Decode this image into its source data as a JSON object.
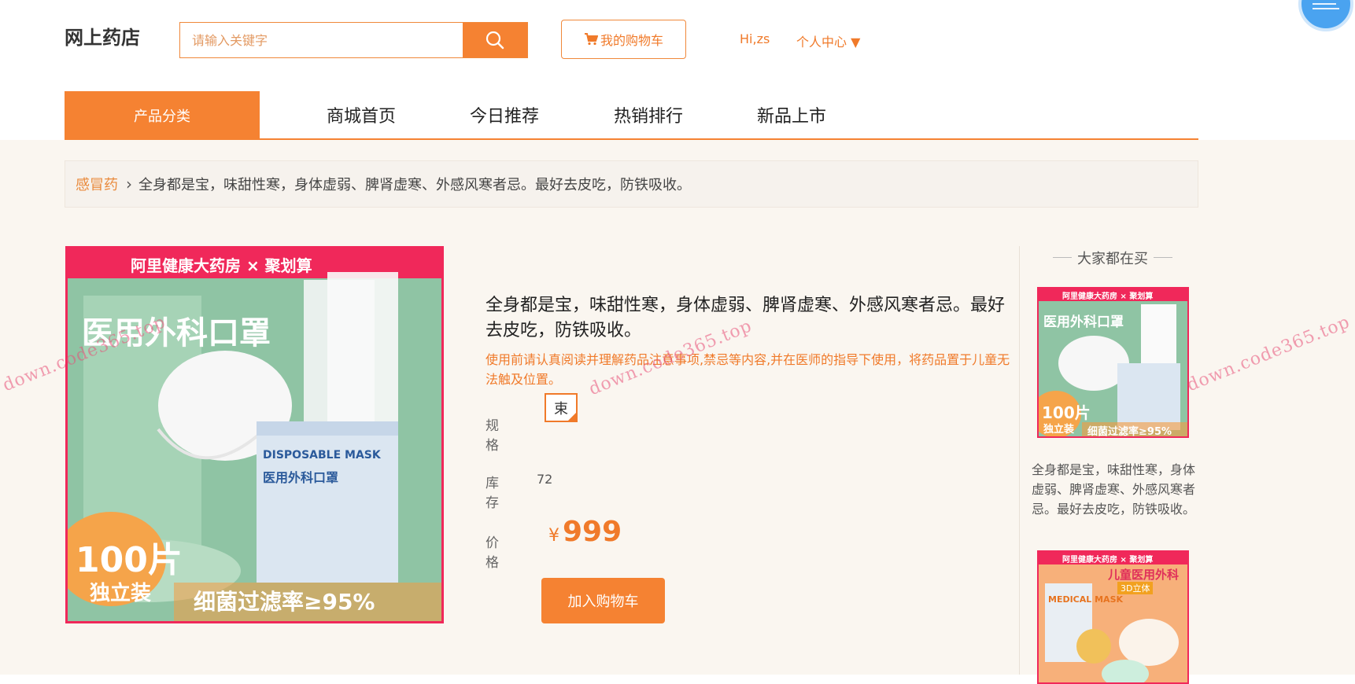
{
  "header": {
    "logo": "网上药店",
    "search_placeholder": "请输入关键字",
    "cart_label": "我的购物车",
    "greeting": "Hi,zs",
    "user_center": "个人中心 ▼"
  },
  "nav": {
    "category": "产品分类",
    "items": [
      {
        "label": "商城首页"
      },
      {
        "label": "今日推荐"
      },
      {
        "label": "热销排行"
      },
      {
        "label": "新品上市"
      }
    ]
  },
  "breadcrumb": {
    "category": "感冒药",
    "current": "全身都是宝，味甜性寒，身体虚弱、脾肾虚寒、外感风寒者忌。最好去皮吃，防铁吸收。"
  },
  "product": {
    "title": "全身都是宝，味甜性寒，身体虚弱、脾肾虚寒、外感风寒者忌。最好去皮吃，防铁吸收。",
    "notice": "使用前请认真阅读并理解药品注意事项,禁忌等内容,并在医师的指导下使用，将药品置于儿童无法触及位置。",
    "spec_label": "规 格",
    "spec_option": "束",
    "stock_label": "库存",
    "stock_value": "72",
    "price_label": "价 格",
    "currency": "¥",
    "price": "999",
    "add_to_cart": "加入购物车",
    "image": {
      "banner": "阿里健康大药房 × 聚划算",
      "big_text": "医用外科口罩",
      "box_en": "DISPOSABLE MASK",
      "box_cn": "医用外科口罩",
      "count": "100片",
      "count_sub": "独立装",
      "filter_text": "细菌过滤率≥95%"
    }
  },
  "sidebar": {
    "title": "大家都在买",
    "items": [
      {
        "desc": "全身都是宝，味甜性寒，身体虚弱、脾肾虚寒、外感风寒者忌。最好去皮吃，防铁吸收。",
        "banner": "阿里健康大药房 × 聚划算",
        "big_text": "医用外科口罩",
        "count": "100片",
        "count_sub": "独立装",
        "filter_text": "细菌过滤率≥95%"
      },
      {
        "banner": "阿里健康大药房 × 聚划算",
        "big_text": "儿童医用外科",
        "sub_text": "3D立体",
        "box_en": "MEDICAL MASK"
      }
    ]
  },
  "watermark": "down.code365.top",
  "colors": {
    "accent": "#f58232",
    "accent_text": "#f07a2a",
    "image_border": "#f0285a",
    "page_bg": "#faf6f0"
  }
}
